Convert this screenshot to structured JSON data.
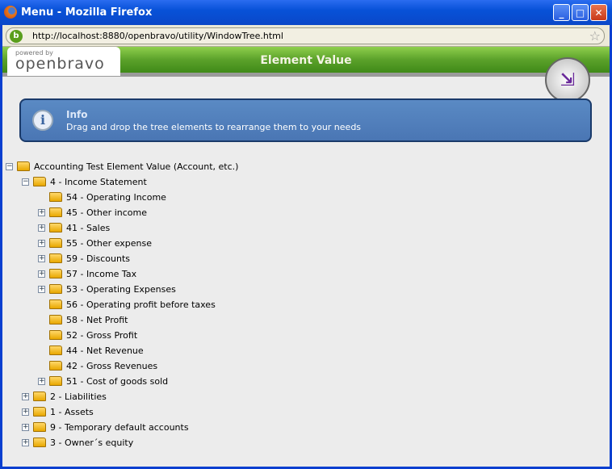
{
  "window": {
    "title": "Menu - Mozilla Firefox",
    "url": "http://localhost:8880/openbravo/utility/WindowTree.html"
  },
  "header": {
    "logo_powered": "powered by",
    "logo_brand": "openbravo",
    "title": "Element Value"
  },
  "info": {
    "title": "Info",
    "text": "Drag and drop the tree elements to rearrange them to your needs"
  },
  "tree": [
    {
      "level": 0,
      "toggle": "minus",
      "label": "Accounting Test Element Value (Account, etc.)"
    },
    {
      "level": 1,
      "toggle": "minus",
      "label": "4 - Income Statement"
    },
    {
      "level": 2,
      "toggle": "",
      "label": "54 - Operating Income"
    },
    {
      "level": 2,
      "toggle": "plus",
      "label": "45 - Other income"
    },
    {
      "level": 2,
      "toggle": "plus",
      "label": "41 - Sales"
    },
    {
      "level": 2,
      "toggle": "plus",
      "label": "55 - Other expense"
    },
    {
      "level": 2,
      "toggle": "plus",
      "label": "59 - Discounts"
    },
    {
      "level": 2,
      "toggle": "plus",
      "label": "57 - Income Tax"
    },
    {
      "level": 2,
      "toggle": "plus",
      "label": "53 - Operating Expenses"
    },
    {
      "level": 2,
      "toggle": "",
      "label": "56 - Operating profit before taxes"
    },
    {
      "level": 2,
      "toggle": "",
      "label": "58 - Net Profit"
    },
    {
      "level": 2,
      "toggle": "",
      "label": "52 - Gross Profit"
    },
    {
      "level": 2,
      "toggle": "",
      "label": "44 - Net Revenue"
    },
    {
      "level": 2,
      "toggle": "",
      "label": "42 - Gross Revenues"
    },
    {
      "level": 2,
      "toggle": "plus",
      "label": "51 - Cost of goods sold"
    },
    {
      "level": 1,
      "toggle": "plus",
      "label": "2 - Liabilities"
    },
    {
      "level": 1,
      "toggle": "plus",
      "label": "1 - Assets"
    },
    {
      "level": 1,
      "toggle": "plus",
      "label": "9 - Temporary default accounts"
    },
    {
      "level": 1,
      "toggle": "plus",
      "label": "3 - Owner´s equity"
    }
  ]
}
